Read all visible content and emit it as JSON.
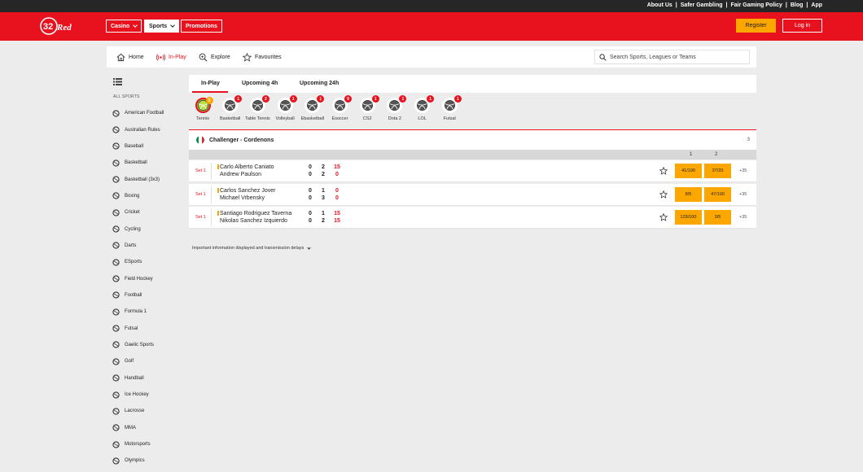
{
  "top_links": [
    "About Us",
    "Safer Gambling",
    "Fair Gaming Policy",
    "Blog",
    "App"
  ],
  "header": {
    "logo_text": "32Red",
    "nav": [
      {
        "label": "Casino",
        "dropdown": true,
        "active": false
      },
      {
        "label": "Sports",
        "dropdown": true,
        "active": true
      },
      {
        "label": "Promotions",
        "dropdown": false,
        "active": false
      }
    ],
    "register_label": "Register",
    "login_label": "Log in"
  },
  "subnav": {
    "items": [
      {
        "label": "Home",
        "icon": "home-icon"
      },
      {
        "label": "In-Play",
        "icon": "live-icon"
      },
      {
        "label": "Explore",
        "icon": "explore-icon"
      },
      {
        "label": "Favourites",
        "icon": "star-icon"
      }
    ],
    "search_placeholder": "Search Sports, Leagues or Teams"
  },
  "sidebar": {
    "heading": "ALL SPORTS",
    "items": [
      "American Football",
      "Australian Rules",
      "Baseball",
      "Basketball",
      "Basketball (3x3)",
      "Boxing",
      "Cricket",
      "Cycling",
      "Darts",
      "ESports",
      "Field Hockey",
      "Football",
      "Formula 1",
      "Futsal",
      "Gaelic Sports",
      "Golf",
      "Handball",
      "Ice Hockey",
      "Lacrosse",
      "MMA",
      "Motorsports",
      "Olympics"
    ]
  },
  "tabs": [
    "In-Play",
    "Upcoming 4h",
    "Upcoming 24h"
  ],
  "sports_row": [
    {
      "label": "Tennis",
      "count": "3",
      "selected": true
    },
    {
      "label": "Basketball",
      "count": "1"
    },
    {
      "label": "Table Tennis",
      "count": "2"
    },
    {
      "label": "Volleyball",
      "count": "1"
    },
    {
      "label": "Ebasketball",
      "count": "1"
    },
    {
      "label": "Esoccer",
      "count": "9"
    },
    {
      "label": "CS2",
      "count": "1"
    },
    {
      "label": "Dota 2",
      "count": "1"
    },
    {
      "label": "LOL",
      "count": "1"
    },
    {
      "label": "Futsal",
      "count": "1"
    }
  ],
  "competition": {
    "title": "Challenger - Cordenons",
    "count": "3"
  },
  "market_headers": [
    "1",
    "2"
  ],
  "matches": [
    {
      "set": "Set 1",
      "p1": "Carlo Alberto Caniato",
      "p2": "Andrew Paulson",
      "p1_scores": [
        "0",
        "2",
        "15"
      ],
      "p2_scores": [
        "0",
        "2",
        "0"
      ],
      "serving": "p1",
      "odd1": "41/100",
      "odd2": "37/20",
      "more": "+35"
    },
    {
      "set": "Set 1",
      "p1": "Carlos Sanchez Jover",
      "p2": "Michael Vrbensky",
      "p1_scores": [
        "0",
        "1",
        "0"
      ],
      "p2_scores": [
        "0",
        "3",
        "0"
      ],
      "serving": "p1",
      "odd1": "8/5",
      "odd2": "47/100",
      "more": "+35"
    },
    {
      "set": "Set 1",
      "p1": "Santiago Rodriguez Taverna",
      "p2": "Nikolas Sanchez Izquierdo",
      "p1_scores": [
        "0",
        "1",
        "15"
      ],
      "p2_scores": [
        "0",
        "2",
        "15"
      ],
      "serving": "p1",
      "odd1": "129/100",
      "odd2": "3/5",
      "more": "+35"
    }
  ],
  "info_text": "Important information displayed and transmission delays",
  "colors": {
    "brand_red": "#e8121e",
    "odds_orange": "#fca600",
    "top_bar": "#262626"
  }
}
